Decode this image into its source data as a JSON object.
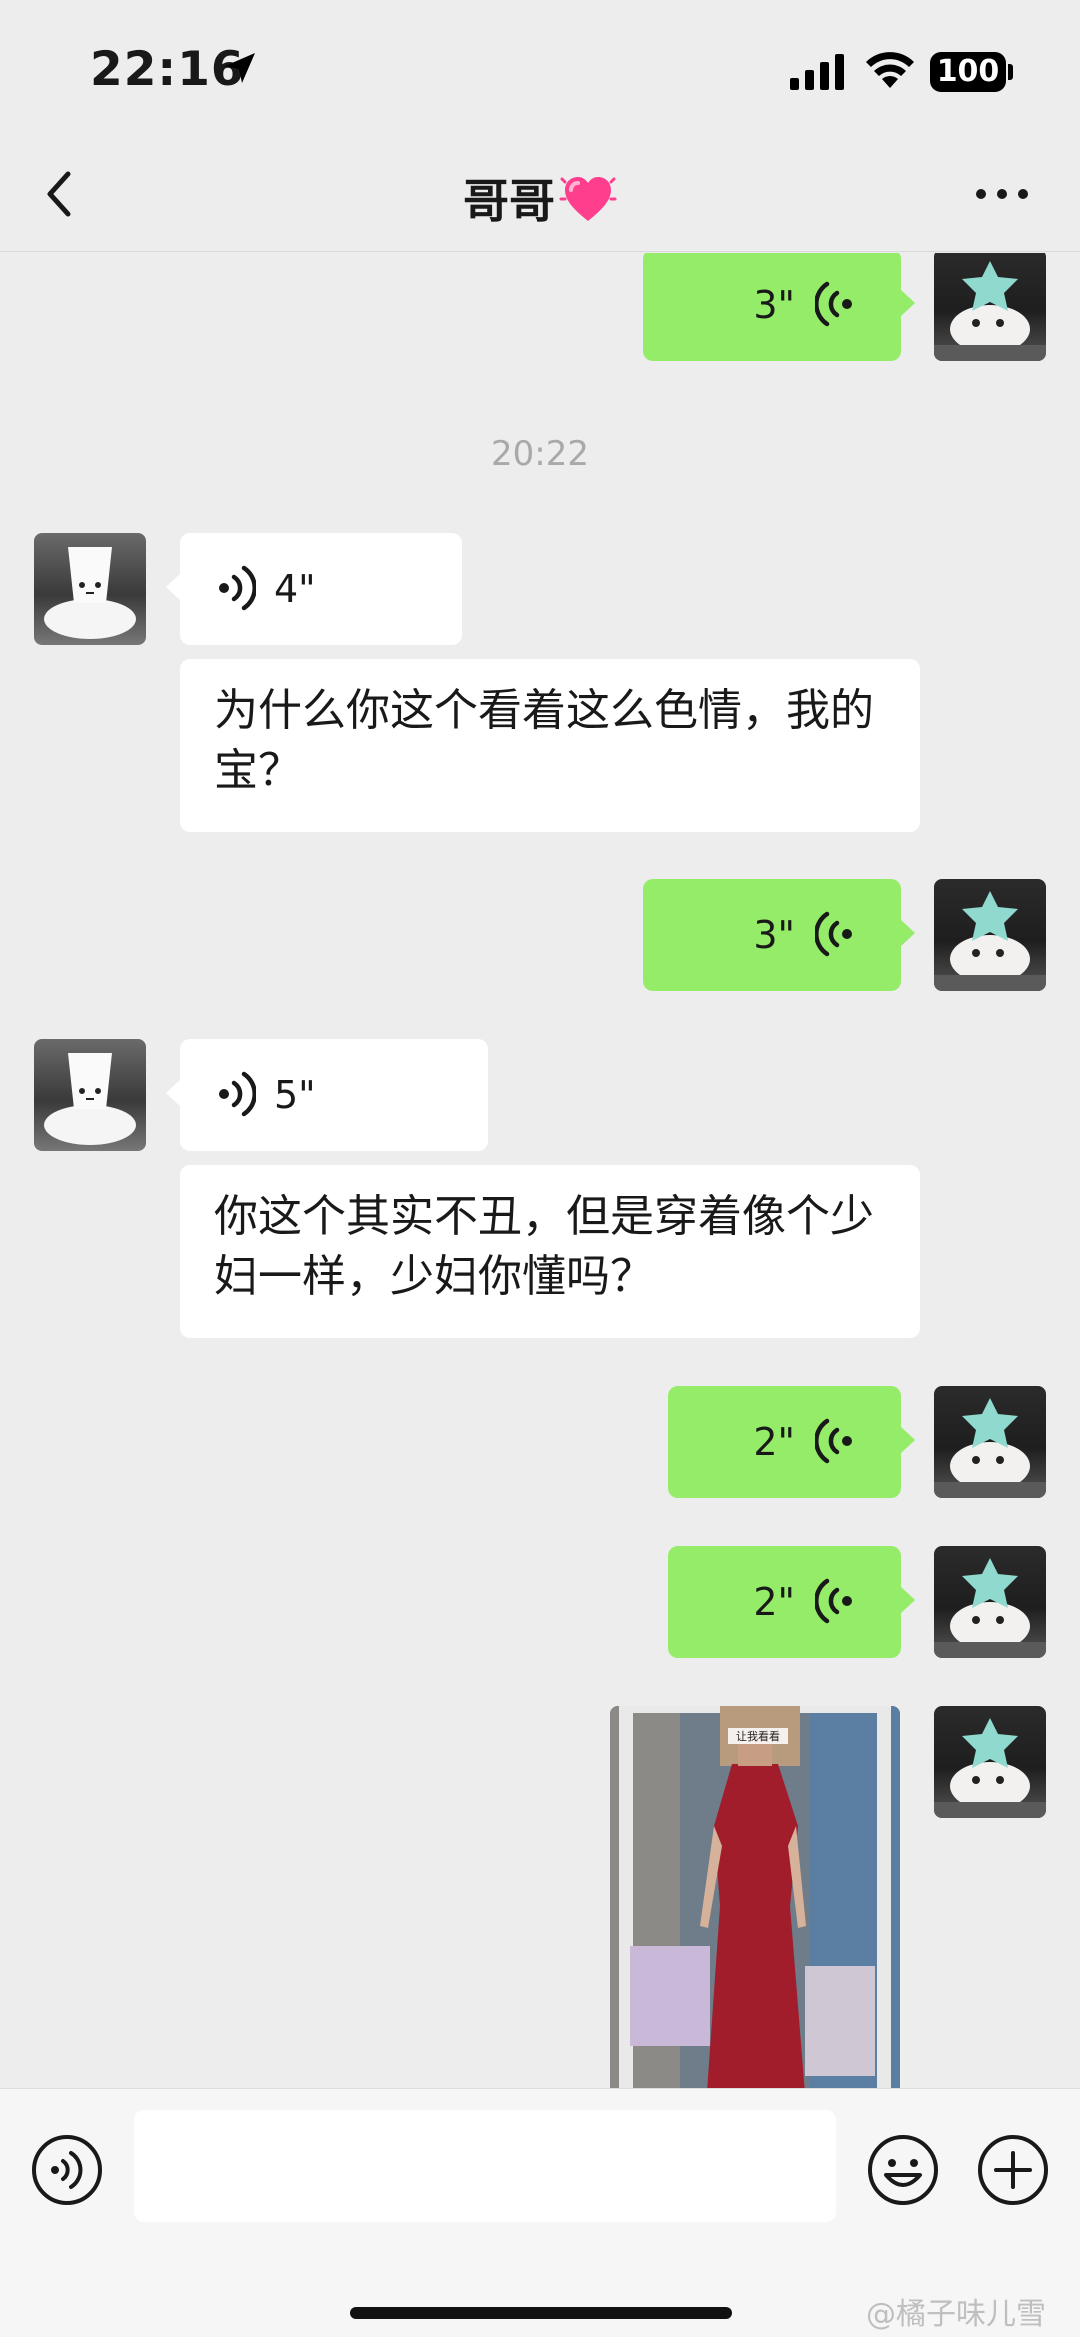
{
  "status_bar": {
    "time": "22:16",
    "battery": "100"
  },
  "nav": {
    "title": "哥哥"
  },
  "messages": [
    {
      "side": "out",
      "type": "voice",
      "duration": "3\""
    },
    {
      "type": "timestamp",
      "text": "20:22"
    },
    {
      "side": "in",
      "type": "voice",
      "duration": "4\""
    },
    {
      "side": "in",
      "type": "text",
      "text": "为什么你这个看着这么色情，我的宝？"
    },
    {
      "side": "out",
      "type": "voice",
      "duration": "3\""
    },
    {
      "side": "in",
      "type": "voice",
      "duration": "5\""
    },
    {
      "side": "in",
      "type": "text",
      "text": "你这个其实不丑，但是穿着像个少妇一样，少妇你懂吗？"
    },
    {
      "side": "out",
      "type": "voice",
      "duration": "2\""
    },
    {
      "side": "out",
      "type": "voice",
      "duration": "2\""
    },
    {
      "side": "out",
      "type": "image",
      "caption": "让我看看"
    }
  ],
  "input_bar": {
    "placeholder": ""
  },
  "watermark": "@橘子味儿雪",
  "colors": {
    "background": "#ededed",
    "outgoing_bubble": "#95ec69",
    "incoming_bubble": "#ffffff",
    "timestamp": "#a9a9a9"
  }
}
